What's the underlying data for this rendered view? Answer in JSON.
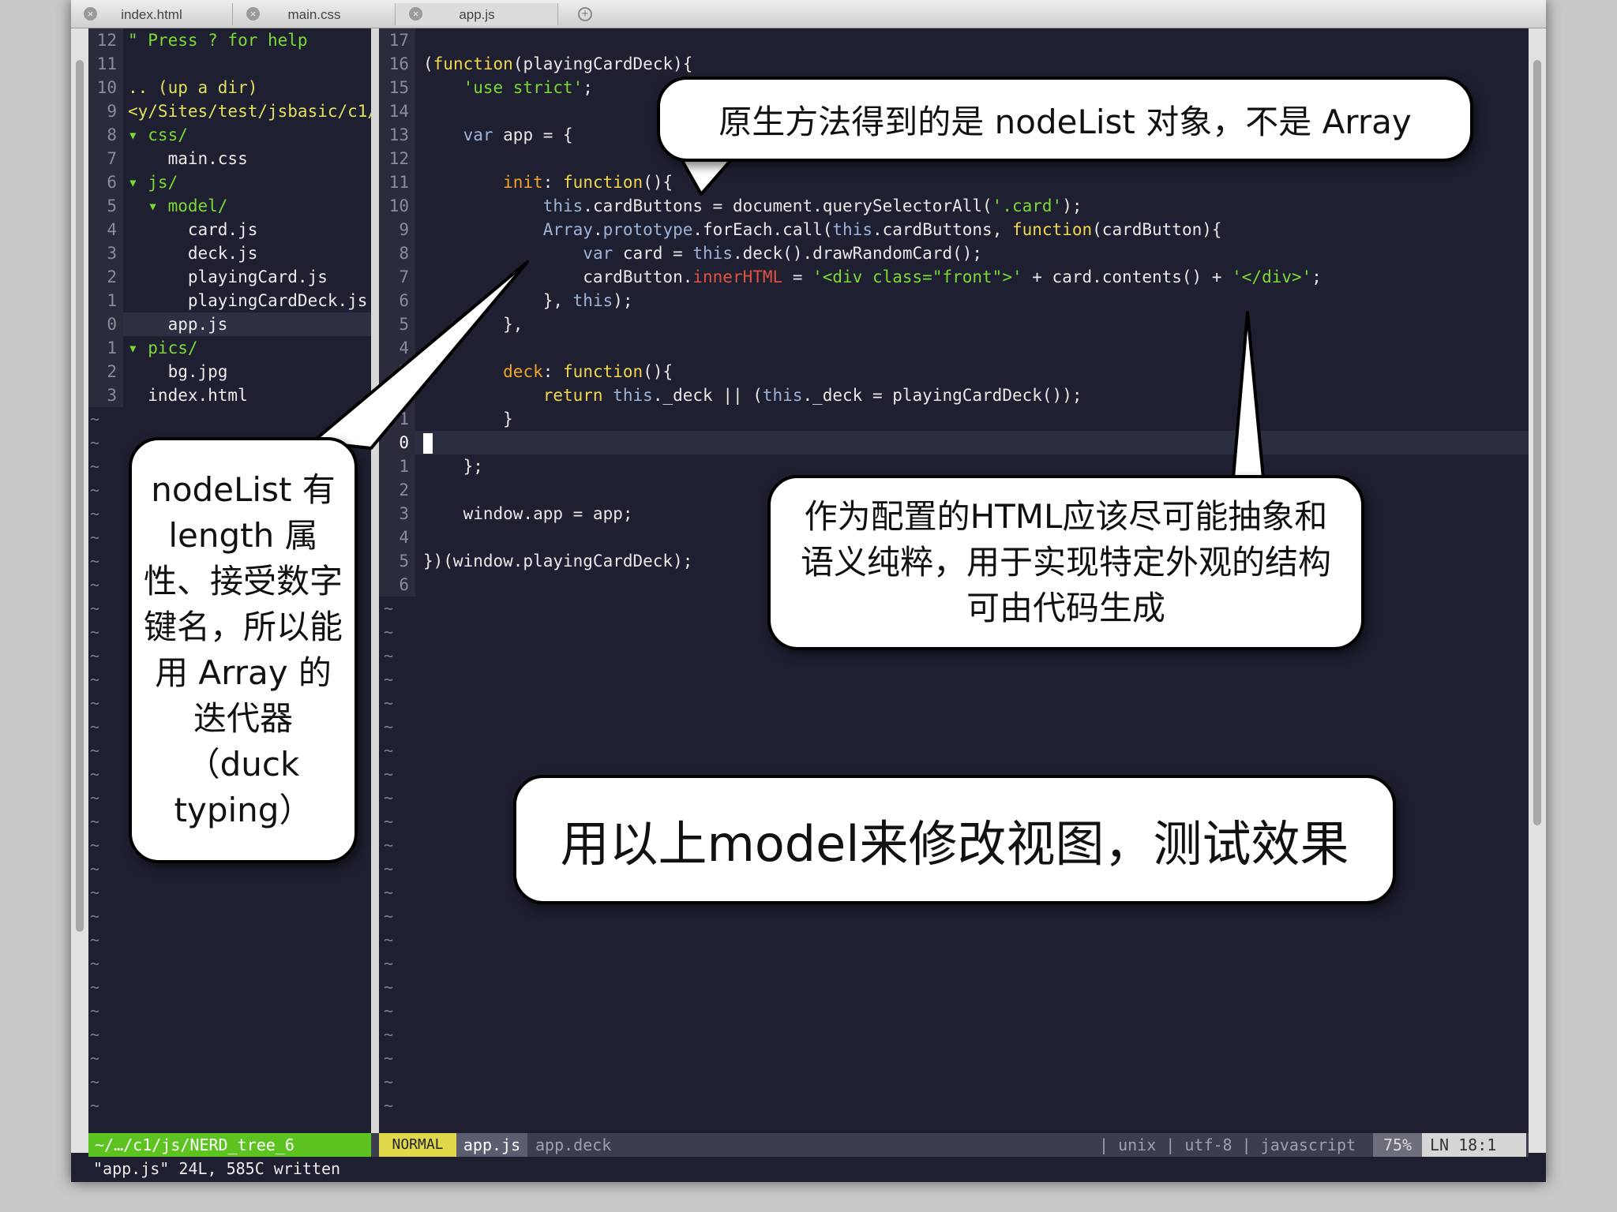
{
  "tabs": [
    {
      "label": "index.html",
      "close": "×"
    },
    {
      "label": "main.css",
      "close": "×"
    },
    {
      "label": "app.js",
      "close": "×"
    }
  ],
  "tab_add": "+",
  "nerdtree": {
    "lines": [
      {
        "num": "12",
        "text": "\" Press ? for help"
      },
      {
        "num": "11",
        "text": ""
      },
      {
        "num": "10",
        "text": ".. (up a dir)"
      },
      {
        "num": "9",
        "text": "<y/Sites/test/jsbasic/c1/"
      },
      {
        "num": "8",
        "text": "▾ css/"
      },
      {
        "num": "7",
        "text": "    main.css"
      },
      {
        "num": "6",
        "text": "▾ js/"
      },
      {
        "num": "5",
        "text": "  ▾ model/"
      },
      {
        "num": "4",
        "text": "      card.js"
      },
      {
        "num": "3",
        "text": "      deck.js"
      },
      {
        "num": "2",
        "text": "      playingCard.js"
      },
      {
        "num": "1",
        "text": "      playingCardDeck.js"
      },
      {
        "num": "0",
        "text": "    app.js"
      },
      {
        "num": "1",
        "text": "▾ pics/"
      },
      {
        "num": "2",
        "text": "    bg.jpg"
      },
      {
        "num": "3",
        "text": "  index.html"
      }
    ],
    "tilde": "~"
  },
  "code": {
    "lines": [
      {
        "num": "17",
        "segs": []
      },
      {
        "num": "16",
        "segs": [
          [
            "(",
            "k-ident"
          ],
          [
            "function",
            "k-yellow"
          ],
          [
            "(playingCardDeck){",
            "k-ident"
          ]
        ]
      },
      {
        "num": "15",
        "segs": [
          [
            "    ",
            "k-ident"
          ],
          [
            "'use strict'",
            "k-green"
          ],
          [
            ";",
            "k-ident"
          ]
        ]
      },
      {
        "num": "14",
        "segs": []
      },
      {
        "num": "13",
        "segs": [
          [
            "    ",
            "k-ident"
          ],
          [
            "var",
            "k-blue"
          ],
          [
            " app = {",
            "k-ident"
          ]
        ]
      },
      {
        "num": "12",
        "segs": []
      },
      {
        "num": "11",
        "segs": [
          [
            "        ",
            "k-ident"
          ],
          [
            "init",
            "k-orange"
          ],
          [
            ": ",
            "k-ident"
          ],
          [
            "function",
            "k-yellow"
          ],
          [
            "(){",
            "k-ident"
          ]
        ]
      },
      {
        "num": "10",
        "segs": [
          [
            "            ",
            "k-ident"
          ],
          [
            "this",
            "k-blue"
          ],
          [
            ".cardButtons = document.querySelectorAll(",
            "k-ident"
          ],
          [
            "'.card'",
            "k-green"
          ],
          [
            ");",
            "k-ident"
          ]
        ]
      },
      {
        "num": "9",
        "segs": [
          [
            "            ",
            "k-ident"
          ],
          [
            "Array",
            "k-blue"
          ],
          [
            ".",
            "k-ident"
          ],
          [
            "prototype",
            "k-blue"
          ],
          [
            ".forEach.call(",
            "k-ident"
          ],
          [
            "this",
            "k-blue"
          ],
          [
            ".cardButtons, ",
            "k-ident"
          ],
          [
            "function",
            "k-yellow"
          ],
          [
            "(cardButton){",
            "k-ident"
          ]
        ]
      },
      {
        "num": "8",
        "segs": [
          [
            "                ",
            "k-ident"
          ],
          [
            "var",
            "k-blue"
          ],
          [
            " card = ",
            "k-ident"
          ],
          [
            "this",
            "k-blue"
          ],
          [
            ".deck().drawRandomCard();",
            "k-ident"
          ]
        ]
      },
      {
        "num": "7",
        "segs": [
          [
            "                cardButton.",
            "k-ident"
          ],
          [
            "innerHTML",
            "k-red"
          ],
          [
            " = ",
            "k-ident"
          ],
          [
            "'<div class=\"front\">'",
            "k-green"
          ],
          [
            " + card.contents() + ",
            "k-ident"
          ],
          [
            "'</div>'",
            "k-green"
          ],
          [
            ";",
            "k-ident"
          ]
        ]
      },
      {
        "num": "6",
        "segs": [
          [
            "            }, ",
            "k-ident"
          ],
          [
            "this",
            "k-blue"
          ],
          [
            ");",
            "k-ident"
          ]
        ]
      },
      {
        "num": "5",
        "segs": [
          [
            "        },",
            "k-ident"
          ]
        ]
      },
      {
        "num": "4",
        "segs": []
      },
      {
        "num": "3",
        "segs": [
          [
            "        ",
            "k-ident"
          ],
          [
            "deck",
            "k-orange"
          ],
          [
            ": ",
            "k-ident"
          ],
          [
            "function",
            "k-yellow"
          ],
          [
            "(){",
            "k-ident"
          ]
        ]
      },
      {
        "num": "2",
        "segs": [
          [
            "            ",
            "k-ident"
          ],
          [
            "return",
            "k-yellow"
          ],
          [
            " ",
            "k-ident"
          ],
          [
            "this",
            "k-blue"
          ],
          [
            "._deck || (",
            "k-ident"
          ],
          [
            "this",
            "k-blue"
          ],
          [
            "._deck = playingCardDeck());",
            "k-ident"
          ]
        ]
      },
      {
        "num": "1",
        "segs": [
          [
            "        }",
            "k-ident"
          ]
        ]
      },
      {
        "num": "0",
        "segs": [],
        "cursor": true
      },
      {
        "num": "1",
        "segs": [
          [
            "    };",
            "k-ident"
          ]
        ]
      },
      {
        "num": "2",
        "segs": []
      },
      {
        "num": "3",
        "segs": [
          [
            "    window.app = app;",
            "k-ident"
          ]
        ]
      },
      {
        "num": "4",
        "segs": []
      },
      {
        "num": "5",
        "segs": [
          [
            "})(window.playingCardDeck);",
            "k-ident"
          ]
        ]
      },
      {
        "num": "6",
        "segs": []
      }
    ],
    "tilde": "~"
  },
  "statusline": {
    "left": "~/…/c1/js/NERD_tree_6",
    "mode": "NORMAL",
    "file": "app.js",
    "func": "app.deck",
    "info": "| unix | utf-8 | javascript",
    "percent": "75%",
    "position": "LN  18:1"
  },
  "cmdline": "\"app.js\" 24L, 585C written",
  "callouts": {
    "top": "原生方法得到的是 nodeList 对象，不是 Array",
    "left": "nodeList 有 length 属性、接受数字键名，所以能用 Array 的迭代器（duck typing）",
    "right": "作为配置的HTML应该尽可能抽象和语义纯粹，用于实现特定外观的结构可由代码生成",
    "bottom": "用以上model来修改视图，测试效果"
  }
}
